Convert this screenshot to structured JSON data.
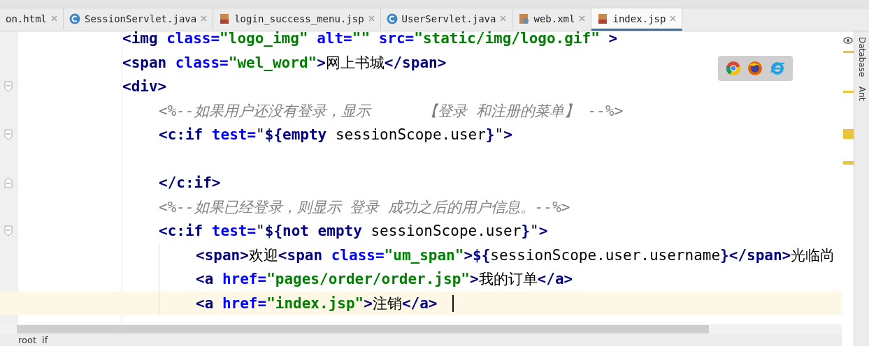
{
  "tabs": [
    {
      "label": "on.html",
      "kind": "html",
      "selected": false
    },
    {
      "label": "SessionServlet.java",
      "kind": "java",
      "selected": false
    },
    {
      "label": "login_success_menu.jsp",
      "kind": "jsp",
      "selected": false
    },
    {
      "label": "UserServlet.java",
      "kind": "java",
      "selected": false
    },
    {
      "label": "web.xml",
      "kind": "xml",
      "selected": false
    },
    {
      "label": "index.jsp",
      "kind": "jsp",
      "selected": true
    }
  ],
  "code_lines": [
    {
      "current": false,
      "tokens": [
        {
          "kind": "tag",
          "text": "<img"
        },
        {
          "kind": "attr",
          "text": " class="
        },
        {
          "kind": "str",
          "text": "\"logo_img\""
        },
        {
          "kind": "attr",
          "text": " alt="
        },
        {
          "kind": "str",
          "text": "\"\""
        },
        {
          "kind": "attr",
          "text": " src="
        },
        {
          "kind": "str",
          "text": "\"static/img/logo.gif\""
        },
        {
          "kind": "tag",
          "text": " >"
        }
      ]
    },
    {
      "current": false,
      "tokens": [
        {
          "kind": "tag",
          "text": "<span"
        },
        {
          "kind": "attr",
          "text": " class="
        },
        {
          "kind": "str",
          "text": "\"wel_word\""
        },
        {
          "kind": "tag",
          "text": ">"
        },
        {
          "kind": "text",
          "text": "网上书城"
        },
        {
          "kind": "tag",
          "text": "</span>"
        }
      ]
    },
    {
      "kind": "open",
      "current": false,
      "tokens": [
        {
          "kind": "tag",
          "text": "<div>"
        }
      ],
      "children": [
        {
          "current": false,
          "tokens": [
            {
              "kind": "comment",
              "text": "<%--如果用户还没有登录，显示      【登录 和注册的菜单】 --%>"
            }
          ]
        },
        {
          "kind": "open",
          "current": false,
          "tokens": [
            {
              "kind": "tag",
              "text": "<c:if"
            },
            {
              "kind": "attr",
              "text": " test="
            },
            {
              "kind": "text",
              "text": "\""
            },
            {
              "kind": "expr",
              "text": "${empty"
            },
            {
              "kind": "text",
              "text": " sessionScope.user"
            },
            {
              "kind": "expr",
              "text": "}"
            },
            {
              "kind": "text",
              "text": "\""
            },
            {
              "kind": "tag",
              "text": ">"
            }
          ]
        },
        {
          "current": false
        },
        {
          "kind": "close",
          "current": false,
          "tokens": [
            {
              "kind": "tag",
              "text": "</c:if>"
            }
          ]
        },
        {
          "current": false,
          "tokens": [
            {
              "kind": "comment",
              "text": "<%--如果已经登录，则显示 登录 成功之后的用户信息。--%>"
            }
          ]
        },
        {
          "kind": "open",
          "current": false,
          "tokens": [
            {
              "kind": "tag",
              "text": "<c:if"
            },
            {
              "kind": "attr",
              "text": " test="
            },
            {
              "kind": "text",
              "text": "\""
            },
            {
              "kind": "expr",
              "text": "${not empty"
            },
            {
              "kind": "text",
              "text": " sessionScope.user"
            },
            {
              "kind": "expr",
              "text": "}"
            },
            {
              "kind": "text",
              "text": "\""
            },
            {
              "kind": "tag",
              "text": ">"
            }
          ],
          "children": [
            {
              "current": false,
              "tokens": [
                {
                  "kind": "tag",
                  "text": "<span>"
                },
                {
                  "kind": "text",
                  "text": "欢迎"
                },
                {
                  "kind": "tag",
                  "text": "<span"
                },
                {
                  "kind": "attr",
                  "text": " class="
                },
                {
                  "kind": "str",
                  "text": "\"um_span\""
                },
                {
                  "kind": "tag",
                  "text": ">"
                },
                {
                  "kind": "expr",
                  "text": "${"
                },
                {
                  "kind": "text",
                  "text": "sessionScope.user.username"
                },
                {
                  "kind": "expr",
                  "text": "}"
                },
                {
                  "kind": "tag",
                  "text": "</span>"
                },
                {
                  "kind": "text",
                  "text": "光临尚"
                }
              ]
            },
            {
              "current": false,
              "tokens": [
                {
                  "kind": "tag",
                  "text": "<a"
                },
                {
                  "kind": "attr",
                  "text": " href="
                },
                {
                  "kind": "str",
                  "text": "\"pages/order/order.jsp\""
                },
                {
                  "kind": "tag",
                  "text": ">"
                },
                {
                  "kind": "text",
                  "text": "我的订单"
                },
                {
                  "kind": "tag",
                  "text": "</a>"
                }
              ]
            },
            {
              "current": true,
              "tokens": [
                {
                  "kind": "tag",
                  "text": "<a"
                },
                {
                  "kind": "attr",
                  "text": " href="
                },
                {
                  "kind": "str",
                  "text": "\"index.jsp\""
                },
                {
                  "kind": "tag",
                  "text": ">"
                },
                {
                  "kind": "text",
                  "text": "注销"
                },
                {
                  "kind": "tag",
                  "text": "</a>"
                }
              ]
            }
          ]
        }
      ]
    }
  ],
  "breadcrumb": [
    "root",
    "if"
  ],
  "side_tools": [
    "Database",
    "Ant"
  ]
}
